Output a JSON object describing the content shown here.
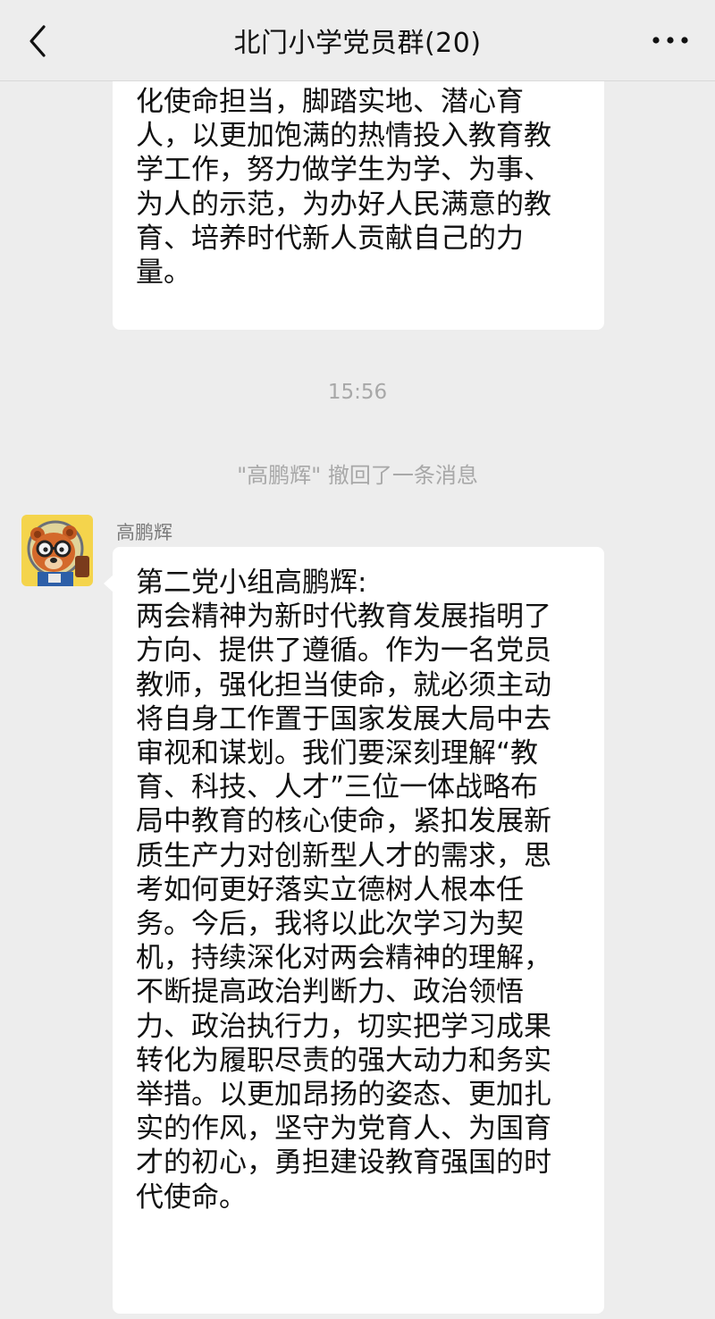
{
  "header": {
    "title": "北门小学党员群(20)",
    "back_icon": "chevron-left-icon",
    "more_icon": "ellipsis-icon"
  },
  "messages": [
    {
      "lines": [
        "化使命担当，脚踏实地、潜心育",
        "人，以更加饱满的热情投入教育教",
        "学工作，努力做学生为学、为事、",
        "为人的示范，为办好人民满意的教",
        "育、培养时代新人贡献自己的力",
        "量。"
      ]
    }
  ],
  "time_divider": "15:56",
  "recall_notice": "\"高鹏辉\" 撤回了一条消息",
  "message2": {
    "sender": "高鹏辉",
    "avatar": "bear-avatar",
    "lines": [
      "第二党小组高鹏辉:",
      "两会精神为新时代教育发展指明了",
      "方向、提供了遵循。作为一名党员",
      "教师，强化担当使命，就必须主动",
      "将自身工作置于国家发展大局中去",
      "审视和谋划。我们要深刻理解“教",
      "育、科技、人才”三位一体战略布",
      "局中教育的核心使命，紧扣发展新",
      "质生产力对创新型人才的需求，思",
      "考如何更好落实立德树人根本任",
      "务。今后，我将以此次学习为契",
      "机，持续深化对两会精神的理解，",
      "不断提高政治判断力、政治领悟",
      "力、政治执行力，切实把学习成果",
      "转化为履职尽责的强大动力和务实",
      "举措。以更加昂扬的姿态、更加扎",
      "实的作风，坚守为党育人、为国育",
      "才的初心，勇担建设教育强国的时",
      "代使命。"
    ]
  },
  "colors": {
    "background": "#ededed",
    "bubble": "#ffffff",
    "meta_text": "#a8a8a8"
  }
}
